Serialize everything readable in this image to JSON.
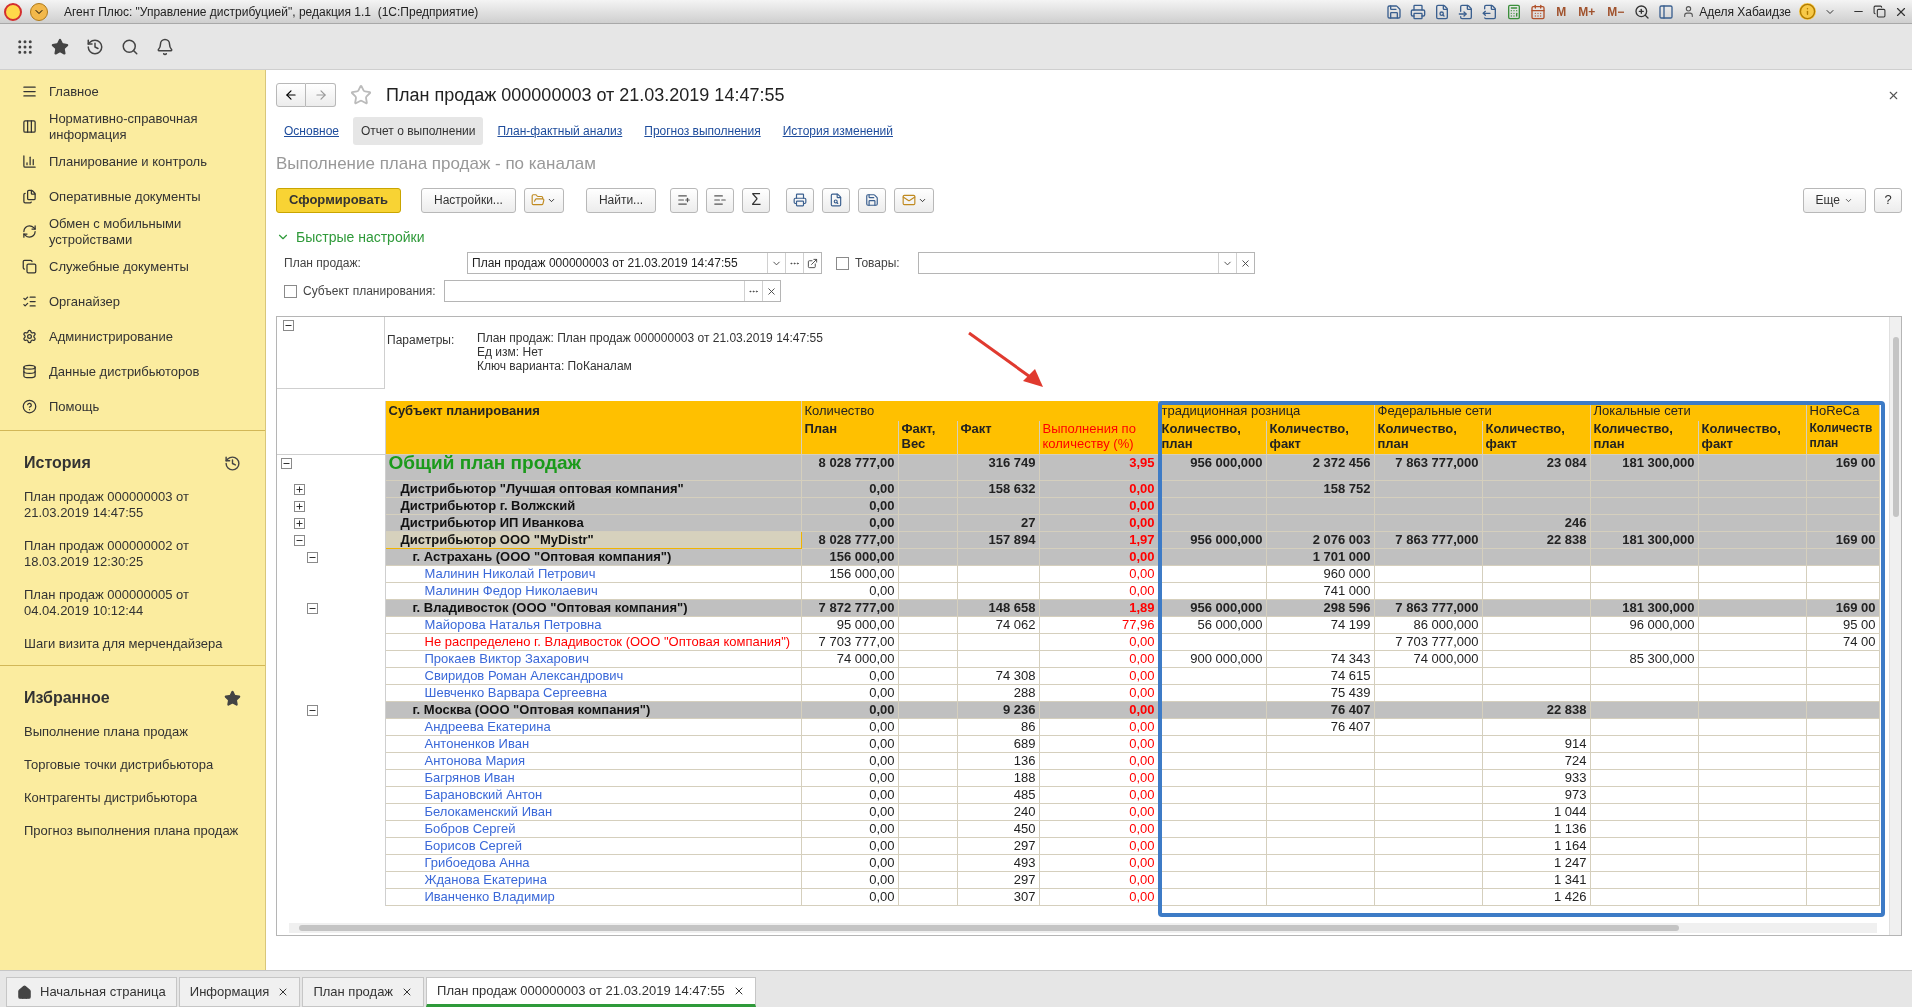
{
  "title_bar": {
    "title": "Агент Плюс: \"Управление дистрибуцией\", редакция 1.1  (1С:Предприятие)",
    "memory_buttons": [
      "M",
      "M+",
      "M−"
    ],
    "user": "Аделя Хабаидзе"
  },
  "sidebar": {
    "sections": [
      {
        "label": "Главное"
      },
      {
        "label": "Нормативно-справочная информация"
      },
      {
        "label": "Планирование и контроль"
      },
      {
        "label": "Оперативные документы"
      },
      {
        "label": "Обмен с мобильными устройствами"
      },
      {
        "label": "Служебные документы"
      },
      {
        "label": "Органайзер"
      },
      {
        "label": "Администрирование"
      },
      {
        "label": "Данные дистрибьюторов"
      },
      {
        "label": "Помощь"
      }
    ],
    "history": {
      "title": "История",
      "items": [
        "План продаж 000000003 от 21.03.2019 14:47:55",
        "План продаж 000000002 от 18.03.2019 12:30:25",
        "План продаж 000000005 от 04.04.2019 10:12:44",
        "Шаги визита для мерчендайзера"
      ]
    },
    "favorites": {
      "title": "Избранное",
      "items": [
        "Выполнение плана продаж",
        "Торговые точки дистрибьютора",
        "Контрагенты дистрибьютора",
        "Прогноз выполнения плана продаж"
      ]
    }
  },
  "document": {
    "title": "План продаж 000000003 от 21.03.2019 14:47:55",
    "tabs": [
      {
        "label": "Основное",
        "selected": false
      },
      {
        "label": "Отчет о выполнении",
        "selected": true
      },
      {
        "label": "План-фактный анализ",
        "selected": false
      },
      {
        "label": "Прогноз выполнения",
        "selected": false
      },
      {
        "label": "История изменений",
        "selected": false
      }
    ],
    "report_title": "Выполнение плана продаж - по каналам",
    "toolbar": {
      "generate": "Сформировать",
      "settings": "Настройки...",
      "find": "Найти...",
      "sum": "Σ",
      "more": "Еще",
      "help": "?"
    },
    "quick_settings": {
      "title": "Быстрые настройки",
      "expanded": true,
      "fields": [
        {
          "kind": "select",
          "label": "План продаж:",
          "value": "План продаж 000000003 от 21.03.2019 14:47:55"
        },
        {
          "kind": "check",
          "label": "Товары:",
          "checked": false
        },
        {
          "kind": "check",
          "label": "Субъект планирования:",
          "checked": false
        }
      ]
    }
  },
  "report": {
    "params": {
      "expanded": true,
      "label": "Параметры:",
      "lines": [
        "План продаж: План продаж 000000003 от 21.03.2019 14:47:55",
        "Ед изм: Нет",
        "Ключ варианта: ПоКаналам"
      ]
    },
    "subject_header": "Субъект планирования",
    "column_groups": [
      {
        "label": "Количество",
        "columns": [
          {
            "kind": "number",
            "label": "План"
          },
          {
            "kind": "number",
            "label": "Факт, Вес"
          },
          {
            "kind": "number",
            "label": "Факт"
          },
          {
            "label": "Выполнения по количеству (%)",
            "kind": "percent"
          }
        ]
      },
      {
        "label": "традиционная розница",
        "columns": [
          {
            "kind": "number",
            "label": "Количество, план"
          },
          {
            "kind": "number",
            "label": "Количество, факт"
          }
        ]
      },
      {
        "label": "Федеральные сети",
        "columns": [
          {
            "kind": "number",
            "label": "Количество, план"
          },
          {
            "kind": "number",
            "label": "Количество, факт"
          }
        ]
      },
      {
        "label": "Локальные сети",
        "columns": [
          {
            "kind": "number",
            "label": "Количество, план"
          },
          {
            "kind": "number",
            "label": "Количество, факт"
          }
        ]
      },
      {
        "label": "HoReCa",
        "columns": [
          {
            "kind": "number",
            "label": "Количеств план"
          }
        ]
      }
    ],
    "rows": [
      {
        "kind": "total",
        "subject": "Общий план продаж",
        "expanded": true,
        "selected": false,
        "values": {
          "plan": "8 028 777,00",
          "fact": "316 749",
          "pct": "3,95",
          "tr_plan": "956 000,000",
          "tr_fact": "2 372 456",
          "fed_plan": "7 863 777,000",
          "fed_fact": "23 084",
          "loc_plan": "181 300,000",
          "horeca_plan": "169 00"
        },
        "children": [
          {
            "kind": "group",
            "subject": "Дистрибьютор \"Лучшая оптовая компания\"",
            "expanded": false,
            "selected": false,
            "values": {
              "plan": "0,00",
              "fact": "158 632",
              "pct": "0,00",
              "tr_fact": "158 752"
            }
          },
          {
            "kind": "group",
            "subject": "Дистрибьютор г. Волжский",
            "expanded": false,
            "selected": false,
            "values": {
              "plan": "0,00",
              "pct": "0,00"
            }
          },
          {
            "kind": "group",
            "subject": "Дистрибьютор ИП Иванкова",
            "expanded": false,
            "selected": false,
            "values": {
              "plan": "0,00",
              "fact": "27",
              "pct": "0,00",
              "fed_fact": "246"
            }
          },
          {
            "kind": "group",
            "subject": "Дистрибьютор ООО \"MyDistr\"",
            "expanded": true,
            "selected": true,
            "values": {
              "plan": "8 028 777,00",
              "fact": "157 894",
              "pct": "1,97",
              "tr_plan": "956 000,000",
              "tr_fact": "2 076 003",
              "fed_plan": "7 863 777,000",
              "fed_fact": "22 838",
              "loc_plan": "181 300,000",
              "horeca_plan": "169 00"
            },
            "children": [
              {
                "kind": "group",
                "subject": "г. Астрахань (ООО \"Оптовая компания\")",
                "expanded": true,
                "selected": false,
                "values": {
                  "plan": "156 000,00",
                  "pct": "0,00",
                  "tr_fact": "1 701 000"
                },
                "children": [
                  {
                    "kind": "person",
                    "subject": "Малинин Николай Петрович",
                    "selected": false,
                    "values": {
                      "plan": "156 000,00",
                      "pct": "0,00",
                      "tr_fact": "960 000"
                    }
                  },
                  {
                    "kind": "person",
                    "subject": "Малинин Федор Николаевич",
                    "selected": false,
                    "values": {
                      "plan": "0,00",
                      "pct": "0,00",
                      "tr_fact": "741 000"
                    }
                  }
                ]
              },
              {
                "kind": "group",
                "subject": "г. Владивосток (ООО \"Оптовая компания\")",
                "expanded": true,
                "selected": false,
                "values": {
                  "plan": "7 872 777,00",
                  "fact": "148 658",
                  "pct": "1,89",
                  "tr_plan": "956 000,000",
                  "tr_fact": "298 596",
                  "fed_plan": "7 863 777,000",
                  "loc_plan": "181 300,000",
                  "horeca_plan": "169 00"
                },
                "children": [
                  {
                    "kind": "person",
                    "subject": "Майорова Наталья Петровна",
                    "selected": false,
                    "values": {
                      "plan": "95 000,00",
                      "fact": "74 062",
                      "pct": "77,96",
                      "tr_plan": "56 000,000",
                      "tr_fact": "74 199",
                      "fed_plan": "86 000,000",
                      "loc_plan": "96 000,000",
                      "horeca_plan": "95 00"
                    }
                  },
                  {
                    "kind": "unassigned",
                    "subject": "Не распределено г. Владивосток (ООО \"Оптовая компания\")",
                    "selected": false,
                    "values": {
                      "plan": "7 703 777,00",
                      "pct": "0,00",
                      "fed_plan": "7 703 777,000",
                      "horeca_plan": "74 00"
                    }
                  },
                  {
                    "kind": "person",
                    "subject": "Прокаев Виктор Захарович",
                    "selected": false,
                    "values": {
                      "plan": "74 000,00",
                      "pct": "0,00",
                      "tr_plan": "900 000,000",
                      "tr_fact": "74 343",
                      "fed_plan": "74 000,000",
                      "loc_plan": "85 300,000"
                    }
                  },
                  {
                    "kind": "person",
                    "subject": "Свиридов Роман Александрович",
                    "selected": false,
                    "values": {
                      "plan": "0,00",
                      "fact": "74 308",
                      "pct": "0,00",
                      "tr_fact": "74 615"
                    }
                  },
                  {
                    "kind": "person",
                    "subject": "Шевченко Варвара Сергеевна",
                    "selected": false,
                    "values": {
                      "plan": "0,00",
                      "fact": "288",
                      "pct": "0,00",
                      "tr_fact": "75 439"
                    }
                  }
                ]
              },
              {
                "kind": "group",
                "subject": "г. Москва  (ООО \"Оптовая компания\")",
                "expanded": true,
                "selected": false,
                "values": {
                  "plan": "0,00",
                  "fact": "9 236",
                  "pct": "0,00",
                  "tr_fact": "76 407",
                  "fed_fact": "22 838"
                },
                "children": [
                  {
                    "kind": "person",
                    "subject": "Андреева Екатерина",
                    "selected": false,
                    "values": {
                      "plan": "0,00",
                      "fact": "86",
                      "pct": "0,00",
                      "tr_fact": "76 407"
                    }
                  },
                  {
                    "kind": "person",
                    "subject": "Антоненков Иван",
                    "selected": false,
                    "values": {
                      "plan": "0,00",
                      "fact": "689",
                      "pct": "0,00",
                      "fed_fact": "914"
                    }
                  },
                  {
                    "kind": "person",
                    "subject": "Антонова Мария",
                    "selected": false,
                    "values": {
                      "plan": "0,00",
                      "fact": "136",
                      "pct": "0,00",
                      "fed_fact": "724"
                    }
                  },
                  {
                    "kind": "person",
                    "subject": "Багрянов Иван",
                    "selected": false,
                    "values": {
                      "plan": "0,00",
                      "fact": "188",
                      "pct": "0,00",
                      "fed_fact": "933"
                    }
                  },
                  {
                    "kind": "person",
                    "subject": "Барановский Антон",
                    "selected": false,
                    "values": {
                      "plan": "0,00",
                      "fact": "485",
                      "pct": "0,00",
                      "fed_fact": "973"
                    }
                  },
                  {
                    "kind": "person",
                    "subject": "Белокаменский Иван",
                    "selected": false,
                    "values": {
                      "plan": "0,00",
                      "fact": "240",
                      "pct": "0,00",
                      "fed_fact": "1 044"
                    }
                  },
                  {
                    "kind": "person",
                    "subject": "Бобров Сергей",
                    "selected": false,
                    "values": {
                      "plan": "0,00",
                      "fact": "450",
                      "pct": "0,00",
                      "fed_fact": "1 136"
                    }
                  },
                  {
                    "kind": "person",
                    "subject": "Борисов Сергей",
                    "selected": false,
                    "values": {
                      "plan": "0,00",
                      "fact": "297",
                      "pct": "0,00",
                      "fed_fact": "1 164"
                    }
                  },
                  {
                    "kind": "person",
                    "subject": "Грибоедова Анна",
                    "selected": false,
                    "values": {
                      "plan": "0,00",
                      "fact": "493",
                      "pct": "0,00",
                      "fed_fact": "1 247"
                    }
                  },
                  {
                    "kind": "person",
                    "subject": "Жданова Екатерина",
                    "selected": false,
                    "values": {
                      "plan": "0,00",
                      "fact": "297",
                      "pct": "0,00",
                      "fed_fact": "1 341"
                    }
                  },
                  {
                    "kind": "person",
                    "subject": "Иванченко Владимир",
                    "selected": false,
                    "values": {
                      "plan": "0,00",
                      "fact": "307",
                      "pct": "0,00",
                      "fed_fact": "1 426"
                    }
                  }
                ]
              }
            ]
          }
        ]
      }
    ]
  },
  "bottom_tabs": [
    {
      "label": "Начальная страница",
      "kind": "home",
      "selected": false
    },
    {
      "label": "Информация",
      "kind": "closable",
      "selected": false
    },
    {
      "label": "План продаж",
      "kind": "closable",
      "selected": false
    },
    {
      "label": "План продаж 000000003 от 21.03.2019 14:47:55",
      "kind": "closable",
      "selected": true
    }
  ]
}
